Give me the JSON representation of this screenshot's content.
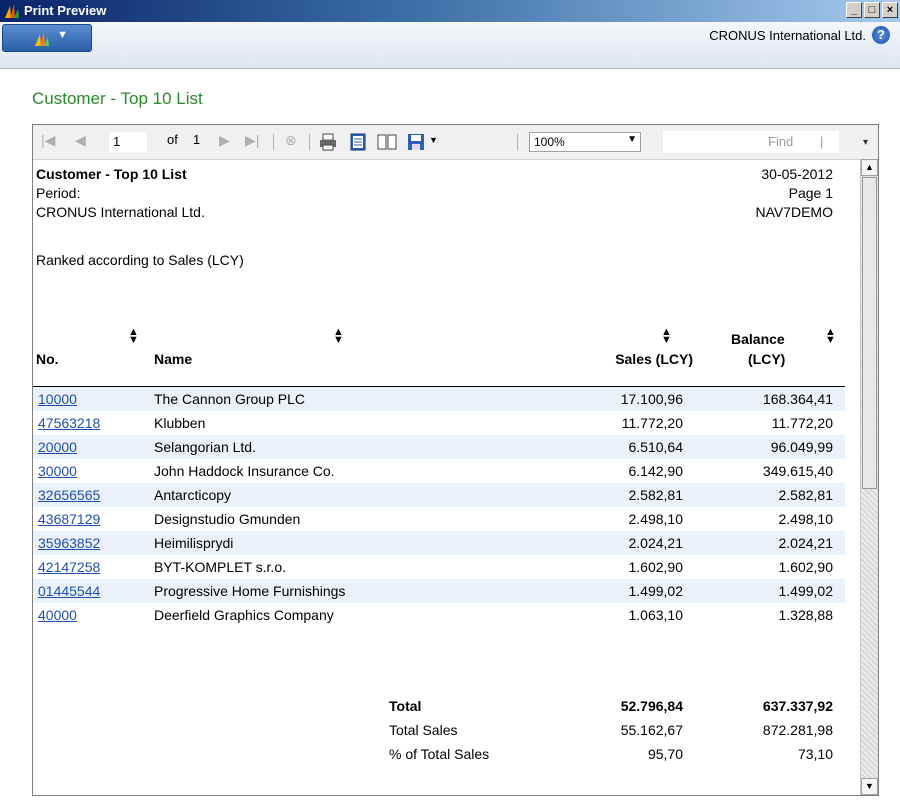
{
  "window": {
    "title": "Print Preview",
    "controls": [
      "_",
      "□",
      "×"
    ]
  },
  "cmdbar": {
    "company": "CRONUS International Ltd.",
    "help_icon": "?"
  },
  "page_title": "Customer - Top 10 List",
  "toolbar": {
    "page_current": "1",
    "of_label": "of",
    "page_total": "1",
    "zoom": "100%",
    "find_label": "Find",
    "find_sep": "|"
  },
  "report": {
    "title": "Customer - Top 10 List",
    "period_label": "Period:",
    "company": "CRONUS International Ltd.",
    "ranked": "Ranked according to Sales (LCY)",
    "date": "30-05-2012",
    "page": "Page 1",
    "user": "NAV7DEMO",
    "columns": {
      "no": "No.",
      "name": "Name",
      "sales": "Sales (LCY)",
      "balance_line1": "Balance",
      "balance_line2": "(LCY)"
    },
    "rows": [
      {
        "no": "10000",
        "name": "The Cannon Group PLC",
        "sales": "17.100,96",
        "balance": "168.364,41"
      },
      {
        "no": "47563218",
        "name": "Klubben",
        "sales": "11.772,20",
        "balance": "11.772,20"
      },
      {
        "no": "20000",
        "name": "Selangorian Ltd.",
        "sales": "6.510,64",
        "balance": "96.049,99"
      },
      {
        "no": "30000",
        "name": "John Haddock Insurance Co.",
        "sales": "6.142,90",
        "balance": "349.615,40"
      },
      {
        "no": "32656565",
        "name": "Antarcticopy",
        "sales": "2.582,81",
        "balance": "2.582,81"
      },
      {
        "no": "43687129",
        "name": "Designstudio Gmunden",
        "sales": "2.498,10",
        "balance": "2.498,10"
      },
      {
        "no": "35963852",
        "name": "Heimilisprydi",
        "sales": "2.024,21",
        "balance": "2.024,21"
      },
      {
        "no": "42147258",
        "name": "BYT-KOMPLET s.r.o.",
        "sales": "1.602,90",
        "balance": "1.602,90"
      },
      {
        "no": "01445544",
        "name": "Progressive Home Furnishings",
        "sales": "1.499,02",
        "balance": "1.499,02"
      },
      {
        "no": "40000",
        "name": "Deerfield Graphics Company",
        "sales": "1.063,10",
        "balance": "1.328,88"
      }
    ],
    "totals": [
      {
        "label": "Total",
        "sales": "52.796,84",
        "balance": "637.337,92",
        "bold": true
      },
      {
        "label": "Total Sales",
        "sales": "55.162,67",
        "balance": "872.281,98",
        "bold": false
      },
      {
        "label": "% of Total Sales",
        "sales": "95,70",
        "balance": "73,10",
        "bold": false
      }
    ]
  },
  "colors": {
    "link": "#1f4fb0",
    "row_shade": "#eaf1fa",
    "page_title": "#2a8a2a"
  }
}
